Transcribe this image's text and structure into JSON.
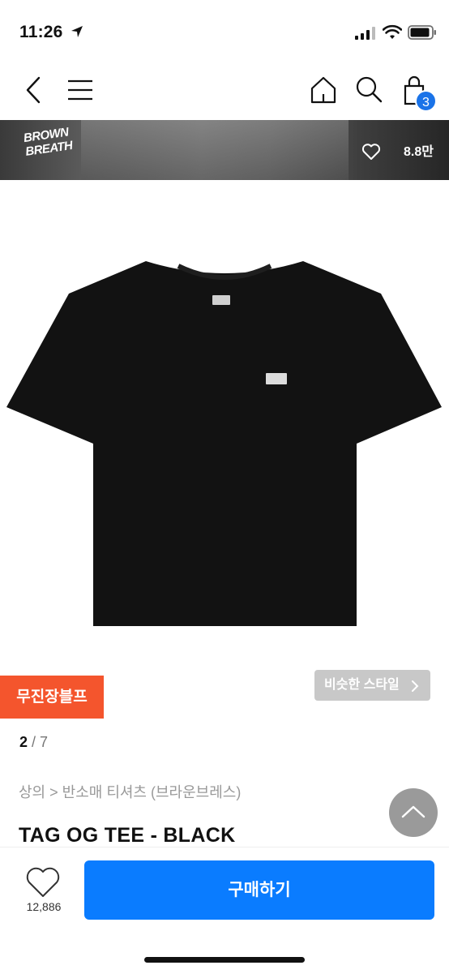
{
  "status_bar": {
    "time": "11:26"
  },
  "nav": {
    "cart_count": "3",
    "icons": [
      "back-icon",
      "menu-icon",
      "home-icon",
      "search-icon",
      "cart-icon"
    ]
  },
  "banner": {
    "brand_logo_line1": "BROWN",
    "brand_logo_line2": "BREATH",
    "likes": "8.8만"
  },
  "product": {
    "tag_badge": "무진장블프",
    "similar_style_label": "비슷한 스타일",
    "page_current": "2",
    "page_total": "/ 7",
    "breadcrumb": "상의 > 반소매 티셔츠 (브라운브레스)",
    "title": "TAG OG TEE - BLACK"
  },
  "bottom_bar": {
    "like_count": "12,886",
    "buy_label": "구매하기"
  },
  "colors": {
    "accent_blue": "#0a7cff",
    "badge_orange": "#f4552d",
    "cart_badge_blue": "#1a73e8"
  }
}
